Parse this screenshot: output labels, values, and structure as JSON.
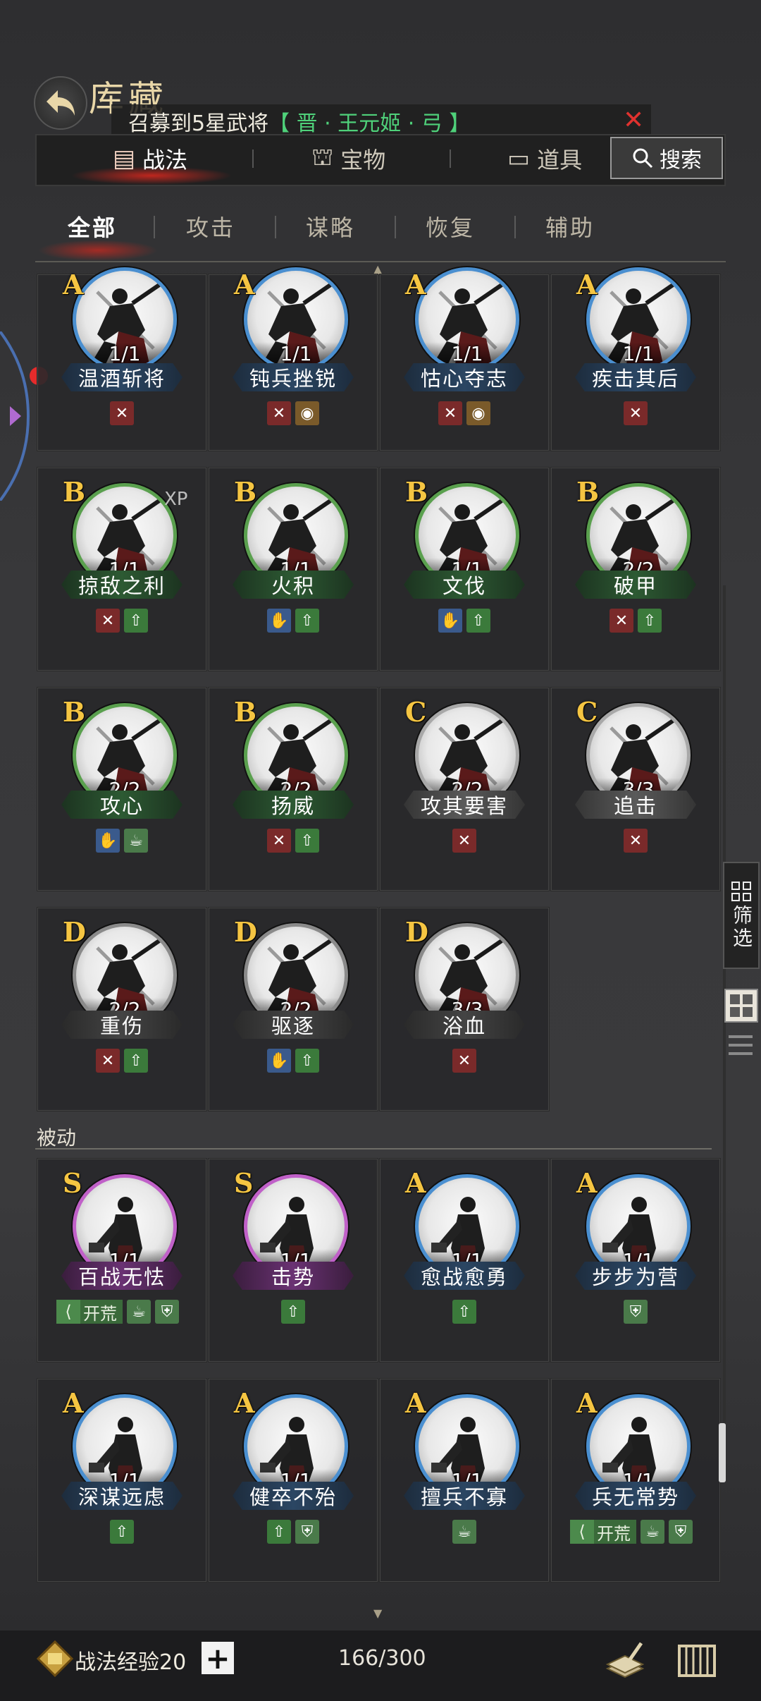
{
  "header": {
    "title": "库藏"
  },
  "banner": {
    "text": "召募到5星武将",
    "highlight": "【 晋 · 王元姬 · 弓 】"
  },
  "top_tabs": [
    {
      "label": "战法",
      "active": true
    },
    {
      "label": "宝物",
      "active": false
    },
    {
      "label": "道具",
      "active": false
    }
  ],
  "search": {
    "label": "搜索"
  },
  "sub_tabs": [
    {
      "label": "全部",
      "active": true
    },
    {
      "label": "攻击",
      "active": false
    },
    {
      "label": "谋略",
      "active": false
    },
    {
      "label": "恢复",
      "active": false
    },
    {
      "label": "辅助",
      "active": false
    }
  ],
  "active_cards": [
    {
      "grade": "A",
      "name": "温酒斩将",
      "count": "1/1",
      "tags": [
        "attack"
      ]
    },
    {
      "grade": "A",
      "name": "钝兵挫锐",
      "count": "1/1",
      "tags": [
        "attack",
        "skull"
      ]
    },
    {
      "grade": "A",
      "name": "怙心夺志",
      "count": "1/1",
      "tags": [
        "attack",
        "skull"
      ]
    },
    {
      "grade": "A",
      "name": "疾击其后",
      "count": "1/1",
      "tags": [
        "attack"
      ]
    },
    {
      "grade": "B",
      "name": "掠敌之利",
      "count": "1/1",
      "tags": [
        "attack",
        "heal"
      ],
      "xp": "XP"
    },
    {
      "grade": "B",
      "name": "火积",
      "count": "1/1",
      "tags": [
        "blue",
        "heal"
      ]
    },
    {
      "grade": "B",
      "name": "文伐",
      "count": "1/1",
      "tags": [
        "blue",
        "heal"
      ]
    },
    {
      "grade": "B",
      "name": "破甲",
      "count": "2/2",
      "tags": [
        "attack",
        "heal"
      ]
    },
    {
      "grade": "B",
      "name": "攻心",
      "count": "2/2",
      "tags": [
        "blue",
        "pot"
      ]
    },
    {
      "grade": "B",
      "name": "扬威",
      "count": "2/2",
      "tags": [
        "attack",
        "heal"
      ]
    },
    {
      "grade": "C",
      "name": "攻其要害",
      "count": "2/2",
      "tags": [
        "attack"
      ]
    },
    {
      "grade": "C",
      "name": "追击",
      "count": "3/3",
      "tags": [
        "attack"
      ]
    },
    {
      "grade": "D",
      "name": "重伤",
      "count": "2/2",
      "tags": [
        "attack",
        "heal"
      ]
    },
    {
      "grade": "D",
      "name": "驱逐",
      "count": "2/2",
      "tags": [
        "blue",
        "heal"
      ]
    },
    {
      "grade": "D",
      "name": "浴血",
      "count": "3/3",
      "tags": [
        "attack"
      ]
    }
  ],
  "passive_section": {
    "label": "被动"
  },
  "passive_cards": [
    {
      "grade": "S",
      "name": "百战无怯",
      "count": "1/1",
      "tags": [
        "pot",
        "shield"
      ],
      "kaihuang": "开荒"
    },
    {
      "grade": "S",
      "name": "击势",
      "count": "1/1",
      "tags": [
        "heal"
      ]
    },
    {
      "grade": "A",
      "name": "愈战愈勇",
      "count": "1/1",
      "tags": [
        "heal"
      ]
    },
    {
      "grade": "A",
      "name": "步步为营",
      "count": "1/1",
      "tags": [
        "shield"
      ]
    },
    {
      "grade": "A",
      "name": "深谋远虑",
      "count": "1/1",
      "tags": [
        "heal"
      ]
    },
    {
      "grade": "A",
      "name": "健卒不殆",
      "count": "1/1",
      "tags": [
        "heal",
        "shield"
      ]
    },
    {
      "grade": "A",
      "name": "擅兵不寡",
      "count": "1/1",
      "tags": [
        "pot"
      ]
    },
    {
      "grade": "A",
      "name": "兵无常势",
      "count": "1/1",
      "tags": [
        "pot",
        "shield"
      ],
      "kaihuang": "开荒"
    }
  ],
  "filter": {
    "label": "筛选"
  },
  "bottom": {
    "xp_label": "战法经验20",
    "plus": "+",
    "capacity": "166/300"
  },
  "colors": {
    "A": "#4a8fd0",
    "B": "#5aa04e",
    "C": "#a8a8a8",
    "D": "#8a8a8a",
    "S": "#c060c8",
    "accent": "#e0322f",
    "grade_text": "#f5c542"
  }
}
